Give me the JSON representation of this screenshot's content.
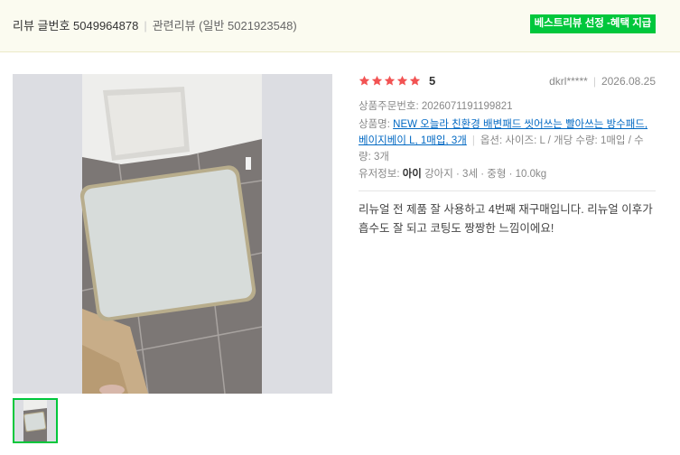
{
  "header": {
    "review_id_label": "리뷰 글번호 5049964878",
    "related_label": "관련리뷰 (일반 5021923548)",
    "best_badge": "베스트리뷰 선정 -혜택 지급"
  },
  "review": {
    "rating": 5,
    "rating_text": "5",
    "writer": "dkrl*****",
    "date": "2026.08.25",
    "order_label": "상품주문번호:",
    "order_number": "2026071191199821",
    "product_label": "상품명:",
    "product_name": "NEW 오늘라 친환경 배변패드 씻어쓰는 빨아쓰는 방수패드, 베이지베이 L, 1매입, 3개",
    "option_text": "옵션: 사이즈: L / 개당 수량: 1매입 / 수량: 3개",
    "user_label": "유저정보:",
    "pet_name": "아이",
    "pet_details": "강아지 · 3세 · 중형 · 10.0kg",
    "content": "리뉴얼 전 제품 잘 사용하고 4번째 재구매입니다. 리뉴얼 이후가 흡수도 잘 되고 코팅도 짱짱한 느낌이에요!"
  },
  "colors": {
    "star": "#f25353",
    "accent_green": "#00c73c",
    "link": "#0068c3",
    "header_bg": "#fbfbf0"
  }
}
